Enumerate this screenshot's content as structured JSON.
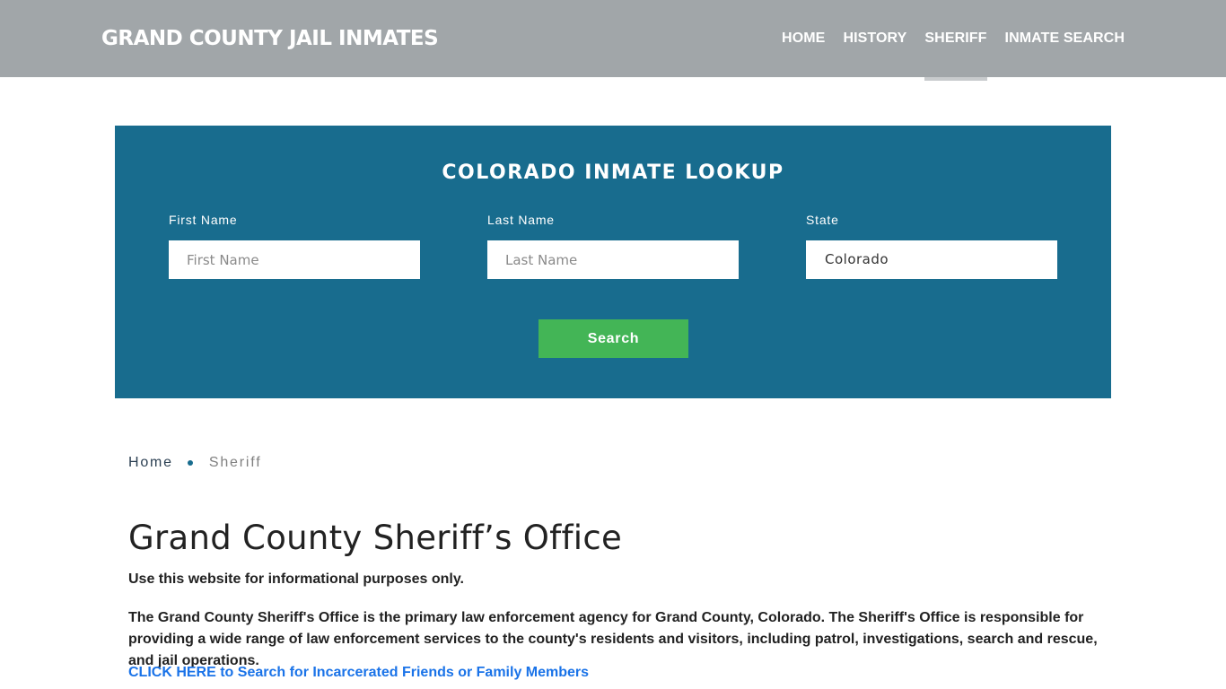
{
  "header": {
    "brand": "GRAND COUNTY JAIL INMATES",
    "nav": [
      {
        "label": "HOME",
        "active": false
      },
      {
        "label": "HISTORY",
        "active": false
      },
      {
        "label": "SHERIFF",
        "active": true
      },
      {
        "label": "INMATE SEARCH",
        "active": false
      }
    ]
  },
  "lookup": {
    "title": "COLORADO INMATE LOOKUP",
    "first_name": {
      "label": "First Name",
      "placeholder": "First Name",
      "value": ""
    },
    "last_name": {
      "label": "Last Name",
      "placeholder": "Last Name",
      "value": ""
    },
    "state": {
      "label": "State",
      "value": "Colorado"
    },
    "search_label": "Search",
    "colors": {
      "panel": "#186c8e",
      "button": "#43b556"
    }
  },
  "breadcrumb": {
    "items": [
      "Home",
      "Sheriff"
    ]
  },
  "main": {
    "title": "Grand County Sheriff’s Office",
    "disclaimer": "Use this website for informational purposes only.",
    "description": "The Grand County Sheriff's Office is the primary law enforcement agency for Grand County, Colorado. The Sheriff's Office is responsible for providing a wide range of law enforcement services to the county's residents and visitors, including patrol, investigations, search and rescue, and jail operations.",
    "cta": "CLICK HERE to Search for Incarcerated Friends or Family Members"
  }
}
